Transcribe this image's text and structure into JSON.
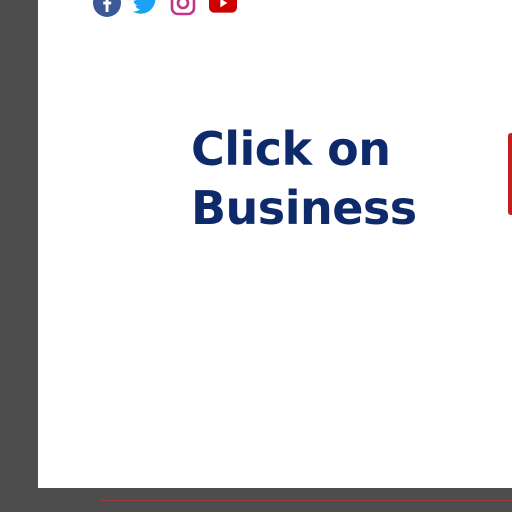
{
  "social": {
    "icons": [
      "facebook-icon",
      "twitter-icon",
      "instagram-icon",
      "youtube-icon"
    ],
    "colors": {
      "facebook": "#3b5998",
      "twitter": "#1da1f2",
      "instagram": "#c13584",
      "youtube": "#cc0000"
    }
  },
  "main": {
    "headline": "Click on Business"
  },
  "colors": {
    "headline": "#0f2a6a",
    "page_bg": "#ffffff",
    "frame": "#4d4d4d",
    "accent": "#c41e1e"
  }
}
